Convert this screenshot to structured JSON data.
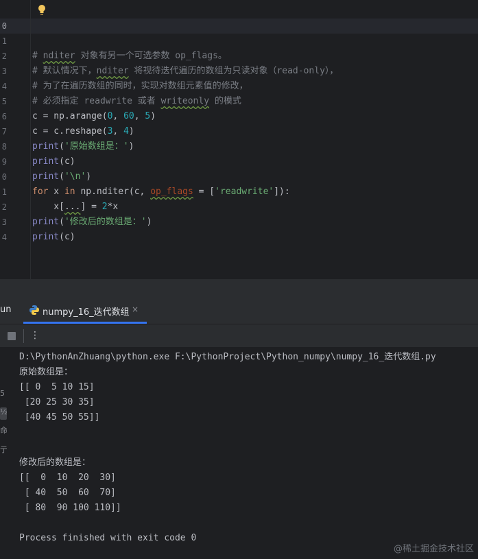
{
  "editor": {
    "line_numbers": [
      "0",
      "1",
      "2",
      "3",
      "4",
      "5",
      "6",
      "7",
      "8",
      "9",
      "0",
      "1",
      "2",
      "3",
      "4"
    ],
    "lines": [
      [],
      [],
      [
        {
          "t": "# ",
          "c": "cm"
        },
        {
          "t": "nditer",
          "c": "cm squig"
        },
        {
          "t": " 对象有另一个可选参数 op_flags。",
          "c": "cm"
        }
      ],
      [
        {
          "t": "# 默认情况下，",
          "c": "cm"
        },
        {
          "t": "nditer",
          "c": "cm squig"
        },
        {
          "t": " 将视待迭代遍历的数组为只读对象（read-only），",
          "c": "cm"
        }
      ],
      [
        {
          "t": "# 为了在遍历数组的同时，实现对数组元素值的修改，",
          "c": "cm"
        }
      ],
      [
        {
          "t": "# 必须指定 readwrite 或者 ",
          "c": "cm"
        },
        {
          "t": "writeonly",
          "c": "cm squig"
        },
        {
          "t": " 的模式",
          "c": "cm"
        }
      ],
      [
        {
          "t": "c = np.arange(",
          "c": ""
        },
        {
          "t": "0",
          "c": "num"
        },
        {
          "t": ", ",
          "c": ""
        },
        {
          "t": "60",
          "c": "num"
        },
        {
          "t": ", ",
          "c": ""
        },
        {
          "t": "5",
          "c": "num"
        },
        {
          "t": ")",
          "c": ""
        }
      ],
      [
        {
          "t": "c = c.reshape(",
          "c": ""
        },
        {
          "t": "3",
          "c": "num"
        },
        {
          "t": ", ",
          "c": ""
        },
        {
          "t": "4",
          "c": "num"
        },
        {
          "t": ")",
          "c": ""
        }
      ],
      [
        {
          "t": "print",
          "c": "bi"
        },
        {
          "t": "(",
          "c": ""
        },
        {
          "t": "'原始数组是：'",
          "c": "str"
        },
        {
          "t": ")",
          "c": ""
        }
      ],
      [
        {
          "t": "print",
          "c": "bi"
        },
        {
          "t": "(c)",
          "c": ""
        }
      ],
      [
        {
          "t": "print",
          "c": "bi"
        },
        {
          "t": "(",
          "c": ""
        },
        {
          "t": "'\\n'",
          "c": "str"
        },
        {
          "t": ")",
          "c": ""
        }
      ],
      [
        {
          "t": "for",
          "c": "kw"
        },
        {
          "t": " x ",
          "c": ""
        },
        {
          "t": "in",
          "c": "kw"
        },
        {
          "t": " np.nditer(c, ",
          "c": ""
        },
        {
          "t": "op_flags",
          "c": "param squig"
        },
        {
          "t": " = [",
          "c": ""
        },
        {
          "t": "'readwrite'",
          "c": "str"
        },
        {
          "t": "]):",
          "c": ""
        }
      ],
      [
        {
          "t": "    x[",
          "c": ""
        },
        {
          "t": "...",
          "c": "squig"
        },
        {
          "t": "] = ",
          "c": ""
        },
        {
          "t": "2",
          "c": "num"
        },
        {
          "t": "*x",
          "c": ""
        }
      ],
      [
        {
          "t": "print",
          "c": "bi"
        },
        {
          "t": "(",
          "c": ""
        },
        {
          "t": "'修改后的数组是：'",
          "c": "str"
        },
        {
          "t": ")",
          "c": ""
        }
      ],
      [
        {
          "t": "print",
          "c": "bi"
        },
        {
          "t": "(c)",
          "c": ""
        }
      ],
      []
    ]
  },
  "run_panel": {
    "run_label": "un",
    "tab_label": "numpy_16_迭代数组",
    "tab_close": "×",
    "more_label": "⋮",
    "rail_labels": [
      "5",
      "½",
      "命",
      "亍"
    ]
  },
  "console": {
    "lines": [
      "D:\\PythonAnZhuang\\python.exe F:\\PythonProject\\Python_numpy\\numpy_16_迭代数组.py",
      "原始数组是：",
      "[[ 0  5 10 15]",
      " [20 25 30 35]",
      " [40 45 50 55]]",
      "",
      "",
      "修改后的数组是：",
      "[[  0  10  20  30]",
      " [ 40  50  60  70]",
      " [ 80  90 100 110]]",
      "",
      "Process finished with exit code 0"
    ]
  },
  "watermark": "@稀土掘金技术社区",
  "colors": {
    "background": "#1e1f22",
    "panel": "#2b2d30",
    "accent": "#3574f0",
    "keyword": "#cf8e6d",
    "string": "#6aab73",
    "number": "#2aacb8",
    "comment": "#7a7e85"
  }
}
